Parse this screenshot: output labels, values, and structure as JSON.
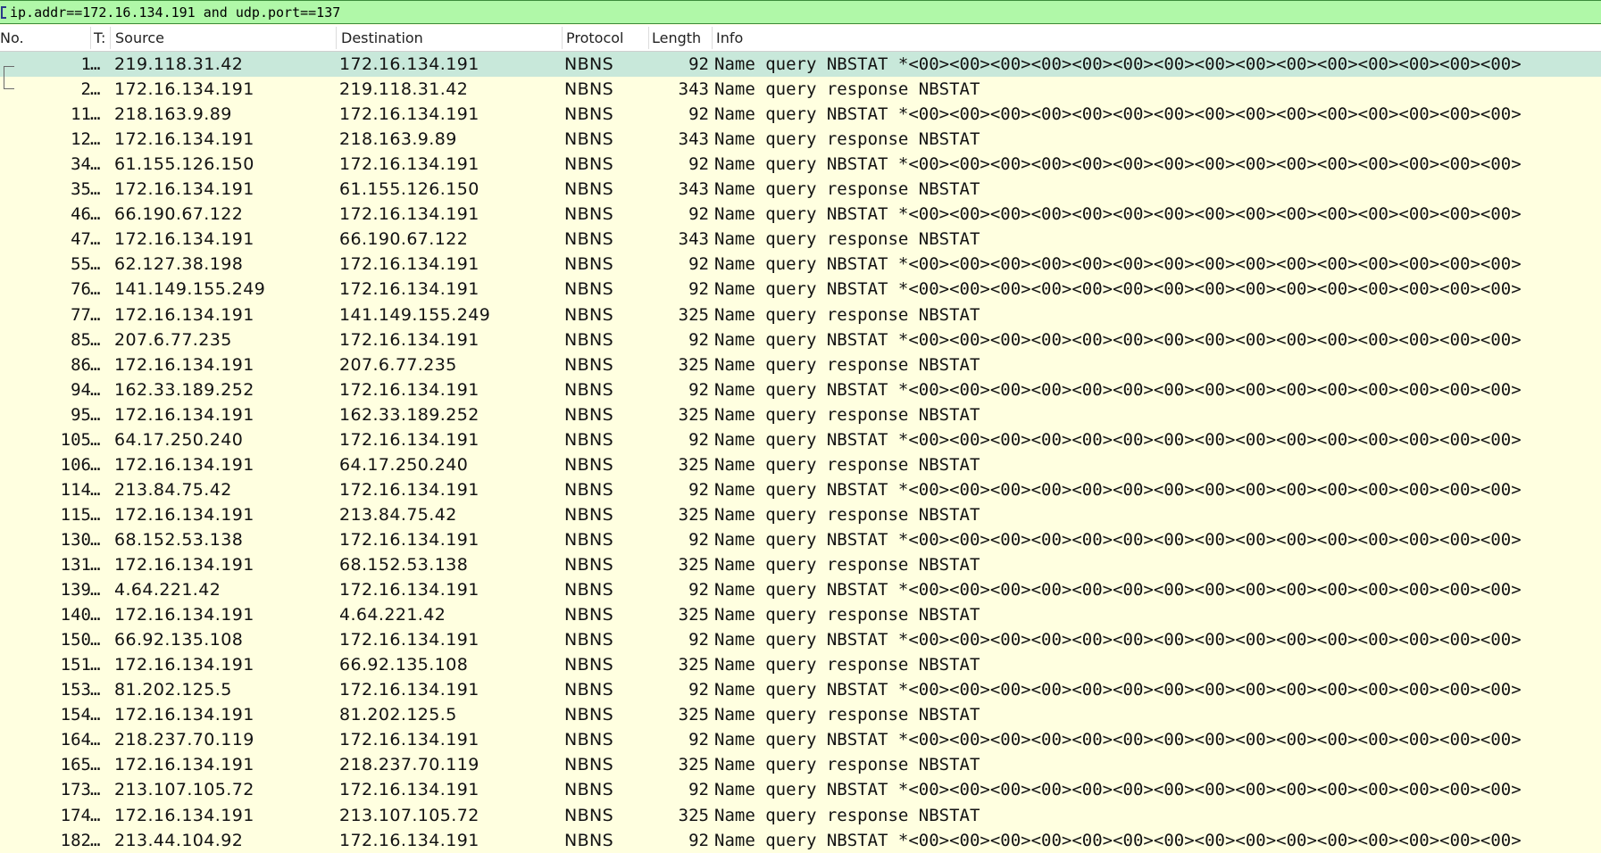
{
  "filter": {
    "value": "ip.addr==172.16.134.191 and udp.port==137"
  },
  "columns": {
    "no": "No.",
    "time": "T:",
    "source": "Source",
    "destination": "Destination",
    "protocol": "Protocol",
    "length": "Length",
    "info": "Info"
  },
  "colors": {
    "row_bg": "#ffffe0",
    "selected_bg": "#c8e8da",
    "filter_bg": "#b0f8a8"
  },
  "rows": [
    {
      "no": "1",
      "t": "…",
      "src": "219.118.31.42",
      "dst": "172.16.134.191",
      "proto": "NBNS",
      "len": "92",
      "info": "Name query NBSTAT *<00><00><00><00><00><00><00><00><00><00><00><00><00><00><00>",
      "selected": true
    },
    {
      "no": "2",
      "t": "…",
      "src": "172.16.134.191",
      "dst": "219.118.31.42",
      "proto": "NBNS",
      "len": "343",
      "info": "Name query response NBSTAT"
    },
    {
      "no": "11",
      "t": "…",
      "src": "218.163.9.89",
      "dst": "172.16.134.191",
      "proto": "NBNS",
      "len": "92",
      "info": "Name query NBSTAT *<00><00><00><00><00><00><00><00><00><00><00><00><00><00><00>"
    },
    {
      "no": "12",
      "t": "…",
      "src": "172.16.134.191",
      "dst": "218.163.9.89",
      "proto": "NBNS",
      "len": "343",
      "info": "Name query response NBSTAT"
    },
    {
      "no": "34",
      "t": "…",
      "src": "61.155.126.150",
      "dst": "172.16.134.191",
      "proto": "NBNS",
      "len": "92",
      "info": "Name query NBSTAT *<00><00><00><00><00><00><00><00><00><00><00><00><00><00><00>"
    },
    {
      "no": "35",
      "t": "…",
      "src": "172.16.134.191",
      "dst": "61.155.126.150",
      "proto": "NBNS",
      "len": "343",
      "info": "Name query response NBSTAT"
    },
    {
      "no": "46",
      "t": "…",
      "src": "66.190.67.122",
      "dst": "172.16.134.191",
      "proto": "NBNS",
      "len": "92",
      "info": "Name query NBSTAT *<00><00><00><00><00><00><00><00><00><00><00><00><00><00><00>"
    },
    {
      "no": "47",
      "t": "…",
      "src": "172.16.134.191",
      "dst": "66.190.67.122",
      "proto": "NBNS",
      "len": "343",
      "info": "Name query response NBSTAT"
    },
    {
      "no": "55",
      "t": "…",
      "src": "62.127.38.198",
      "dst": "172.16.134.191",
      "proto": "NBNS",
      "len": "92",
      "info": "Name query NBSTAT *<00><00><00><00><00><00><00><00><00><00><00><00><00><00><00>"
    },
    {
      "no": "76",
      "t": "…",
      "src": "141.149.155.249",
      "dst": "172.16.134.191",
      "proto": "NBNS",
      "len": "92",
      "info": "Name query NBSTAT *<00><00><00><00><00><00><00><00><00><00><00><00><00><00><00>"
    },
    {
      "no": "77",
      "t": "…",
      "src": "172.16.134.191",
      "dst": "141.149.155.249",
      "proto": "NBNS",
      "len": "325",
      "info": "Name query response NBSTAT"
    },
    {
      "no": "85",
      "t": "…",
      "src": "207.6.77.235",
      "dst": "172.16.134.191",
      "proto": "NBNS",
      "len": "92",
      "info": "Name query NBSTAT *<00><00><00><00><00><00><00><00><00><00><00><00><00><00><00>"
    },
    {
      "no": "86",
      "t": "…",
      "src": "172.16.134.191",
      "dst": "207.6.77.235",
      "proto": "NBNS",
      "len": "325",
      "info": "Name query response NBSTAT"
    },
    {
      "no": "94",
      "t": "…",
      "src": "162.33.189.252",
      "dst": "172.16.134.191",
      "proto": "NBNS",
      "len": "92",
      "info": "Name query NBSTAT *<00><00><00><00><00><00><00><00><00><00><00><00><00><00><00>"
    },
    {
      "no": "95",
      "t": "…",
      "src": "172.16.134.191",
      "dst": "162.33.189.252",
      "proto": "NBNS",
      "len": "325",
      "info": "Name query response NBSTAT"
    },
    {
      "no": "105",
      "t": "…",
      "src": "64.17.250.240",
      "dst": "172.16.134.191",
      "proto": "NBNS",
      "len": "92",
      "info": "Name query NBSTAT *<00><00><00><00><00><00><00><00><00><00><00><00><00><00><00>"
    },
    {
      "no": "106",
      "t": "…",
      "src": "172.16.134.191",
      "dst": "64.17.250.240",
      "proto": "NBNS",
      "len": "325",
      "info": "Name query response NBSTAT"
    },
    {
      "no": "114",
      "t": "…",
      "src": "213.84.75.42",
      "dst": "172.16.134.191",
      "proto": "NBNS",
      "len": "92",
      "info": "Name query NBSTAT *<00><00><00><00><00><00><00><00><00><00><00><00><00><00><00>"
    },
    {
      "no": "115",
      "t": "…",
      "src": "172.16.134.191",
      "dst": "213.84.75.42",
      "proto": "NBNS",
      "len": "325",
      "info": "Name query response NBSTAT"
    },
    {
      "no": "130",
      "t": "…",
      "src": "68.152.53.138",
      "dst": "172.16.134.191",
      "proto": "NBNS",
      "len": "92",
      "info": "Name query NBSTAT *<00><00><00><00><00><00><00><00><00><00><00><00><00><00><00>"
    },
    {
      "no": "131",
      "t": "…",
      "src": "172.16.134.191",
      "dst": "68.152.53.138",
      "proto": "NBNS",
      "len": "325",
      "info": "Name query response NBSTAT"
    },
    {
      "no": "139",
      "t": "…",
      "src": "4.64.221.42",
      "dst": "172.16.134.191",
      "proto": "NBNS",
      "len": "92",
      "info": "Name query NBSTAT *<00><00><00><00><00><00><00><00><00><00><00><00><00><00><00>"
    },
    {
      "no": "140",
      "t": "…",
      "src": "172.16.134.191",
      "dst": "4.64.221.42",
      "proto": "NBNS",
      "len": "325",
      "info": "Name query response NBSTAT"
    },
    {
      "no": "150",
      "t": "…",
      "src": "66.92.135.108",
      "dst": "172.16.134.191",
      "proto": "NBNS",
      "len": "92",
      "info": "Name query NBSTAT *<00><00><00><00><00><00><00><00><00><00><00><00><00><00><00>"
    },
    {
      "no": "151",
      "t": "…",
      "src": "172.16.134.191",
      "dst": "66.92.135.108",
      "proto": "NBNS",
      "len": "325",
      "info": "Name query response NBSTAT"
    },
    {
      "no": "153",
      "t": "…",
      "src": "81.202.125.5",
      "dst": "172.16.134.191",
      "proto": "NBNS",
      "len": "92",
      "info": "Name query NBSTAT *<00><00><00><00><00><00><00><00><00><00><00><00><00><00><00>"
    },
    {
      "no": "154",
      "t": "…",
      "src": "172.16.134.191",
      "dst": "81.202.125.5",
      "proto": "NBNS",
      "len": "325",
      "info": "Name query response NBSTAT"
    },
    {
      "no": "164",
      "t": "…",
      "src": "218.237.70.119",
      "dst": "172.16.134.191",
      "proto": "NBNS",
      "len": "92",
      "info": "Name query NBSTAT *<00><00><00><00><00><00><00><00><00><00><00><00><00><00><00>"
    },
    {
      "no": "165",
      "t": "…",
      "src": "172.16.134.191",
      "dst": "218.237.70.119",
      "proto": "NBNS",
      "len": "325",
      "info": "Name query response NBSTAT"
    },
    {
      "no": "173",
      "t": "…",
      "src": "213.107.105.72",
      "dst": "172.16.134.191",
      "proto": "NBNS",
      "len": "92",
      "info": "Name query NBSTAT *<00><00><00><00><00><00><00><00><00><00><00><00><00><00><00>"
    },
    {
      "no": "174",
      "t": "…",
      "src": "172.16.134.191",
      "dst": "213.107.105.72",
      "proto": "NBNS",
      "len": "325",
      "info": "Name query response NBSTAT"
    },
    {
      "no": "182",
      "t": "…",
      "src": "213.44.104.92",
      "dst": "172.16.134.191",
      "proto": "NBNS",
      "len": "92",
      "info": "Name query NBSTAT *<00><00><00><00><00><00><00><00><00><00><00><00><00><00><00>"
    }
  ]
}
